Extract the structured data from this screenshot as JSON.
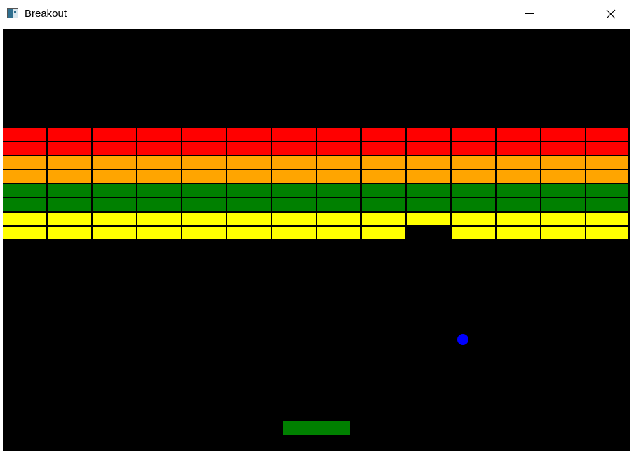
{
  "window": {
    "title": "Breakout",
    "controls": {
      "minimize_icon": "minimize-icon",
      "maximize_icon": "maximize-icon",
      "close_icon": "close-icon"
    }
  },
  "game": {
    "background_color": "#000000",
    "brick_colors": [
      "#ff0000",
      "#ffa500",
      "#008000",
      "#ffff00"
    ],
    "bricks": [
      [
        1,
        1,
        1,
        1,
        1,
        1,
        1,
        1,
        1,
        1,
        1,
        1,
        1,
        1
      ],
      [
        1,
        1,
        1,
        1,
        1,
        1,
        1,
        1,
        1,
        1,
        1,
        1,
        1,
        1
      ],
      [
        1,
        1,
        1,
        1,
        1,
        1,
        1,
        1,
        1,
        1,
        1,
        1,
        1,
        1
      ],
      [
        1,
        1,
        1,
        1,
        1,
        1,
        1,
        1,
        1,
        1,
        1,
        1,
        1,
        1
      ],
      [
        1,
        1,
        1,
        1,
        1,
        1,
        1,
        1,
        1,
        1,
        1,
        1,
        1,
        1
      ],
      [
        1,
        1,
        1,
        1,
        1,
        1,
        1,
        1,
        1,
        1,
        1,
        1,
        1,
        1
      ],
      [
        1,
        1,
        1,
        1,
        1,
        1,
        1,
        1,
        1,
        1,
        1,
        1,
        1,
        1
      ],
      [
        1,
        1,
        1,
        1,
        1,
        1,
        1,
        1,
        1,
        0,
        1,
        1,
        1,
        1
      ]
    ],
    "ball": {
      "color": "#0000ff"
    },
    "paddle": {
      "color": "#008000"
    }
  }
}
